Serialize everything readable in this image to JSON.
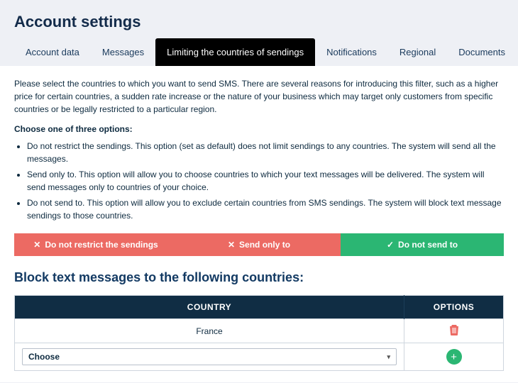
{
  "page_title": "Account settings",
  "tabs": [
    {
      "label": "Account data",
      "active": false
    },
    {
      "label": "Messages",
      "active": false
    },
    {
      "label": "Limiting the countries of sendings",
      "active": true
    },
    {
      "label": "Notifications",
      "active": false
    },
    {
      "label": "Regional",
      "active": false
    },
    {
      "label": "Documents",
      "active": false
    }
  ],
  "intro": "Please select the countries to which you want to send SMS. There are several reasons for introducing this filter, such as a higher price for certain countries, a sudden rate increase or the nature of your business which may target only customers from specific countries or be legally restricted to a particular region.",
  "choose_label": "Choose one of three options:",
  "options": [
    "Do not restrict the sendings. This option (set as default) does not limit sendings to any countries. The system will send all the messages.",
    "Send only to. This option will allow you to choose countries to which your text messages will be delivered. The system will send messages only to countries of your choice.",
    "Do not send to. This option will allow you to exclude certain countries from SMS sendings. The system will block text message sendings to those countries."
  ],
  "buttons": {
    "no_restrict": "Do not restrict the sendings",
    "send_only": "Send only to",
    "no_send": "Do not send to"
  },
  "block_section_title": "Block text messages to the following countries:",
  "table": {
    "header_country": "COUNTRY",
    "header_options": "OPTIONS",
    "rows": [
      {
        "country": "France"
      }
    ],
    "select_placeholder": "Choose"
  }
}
